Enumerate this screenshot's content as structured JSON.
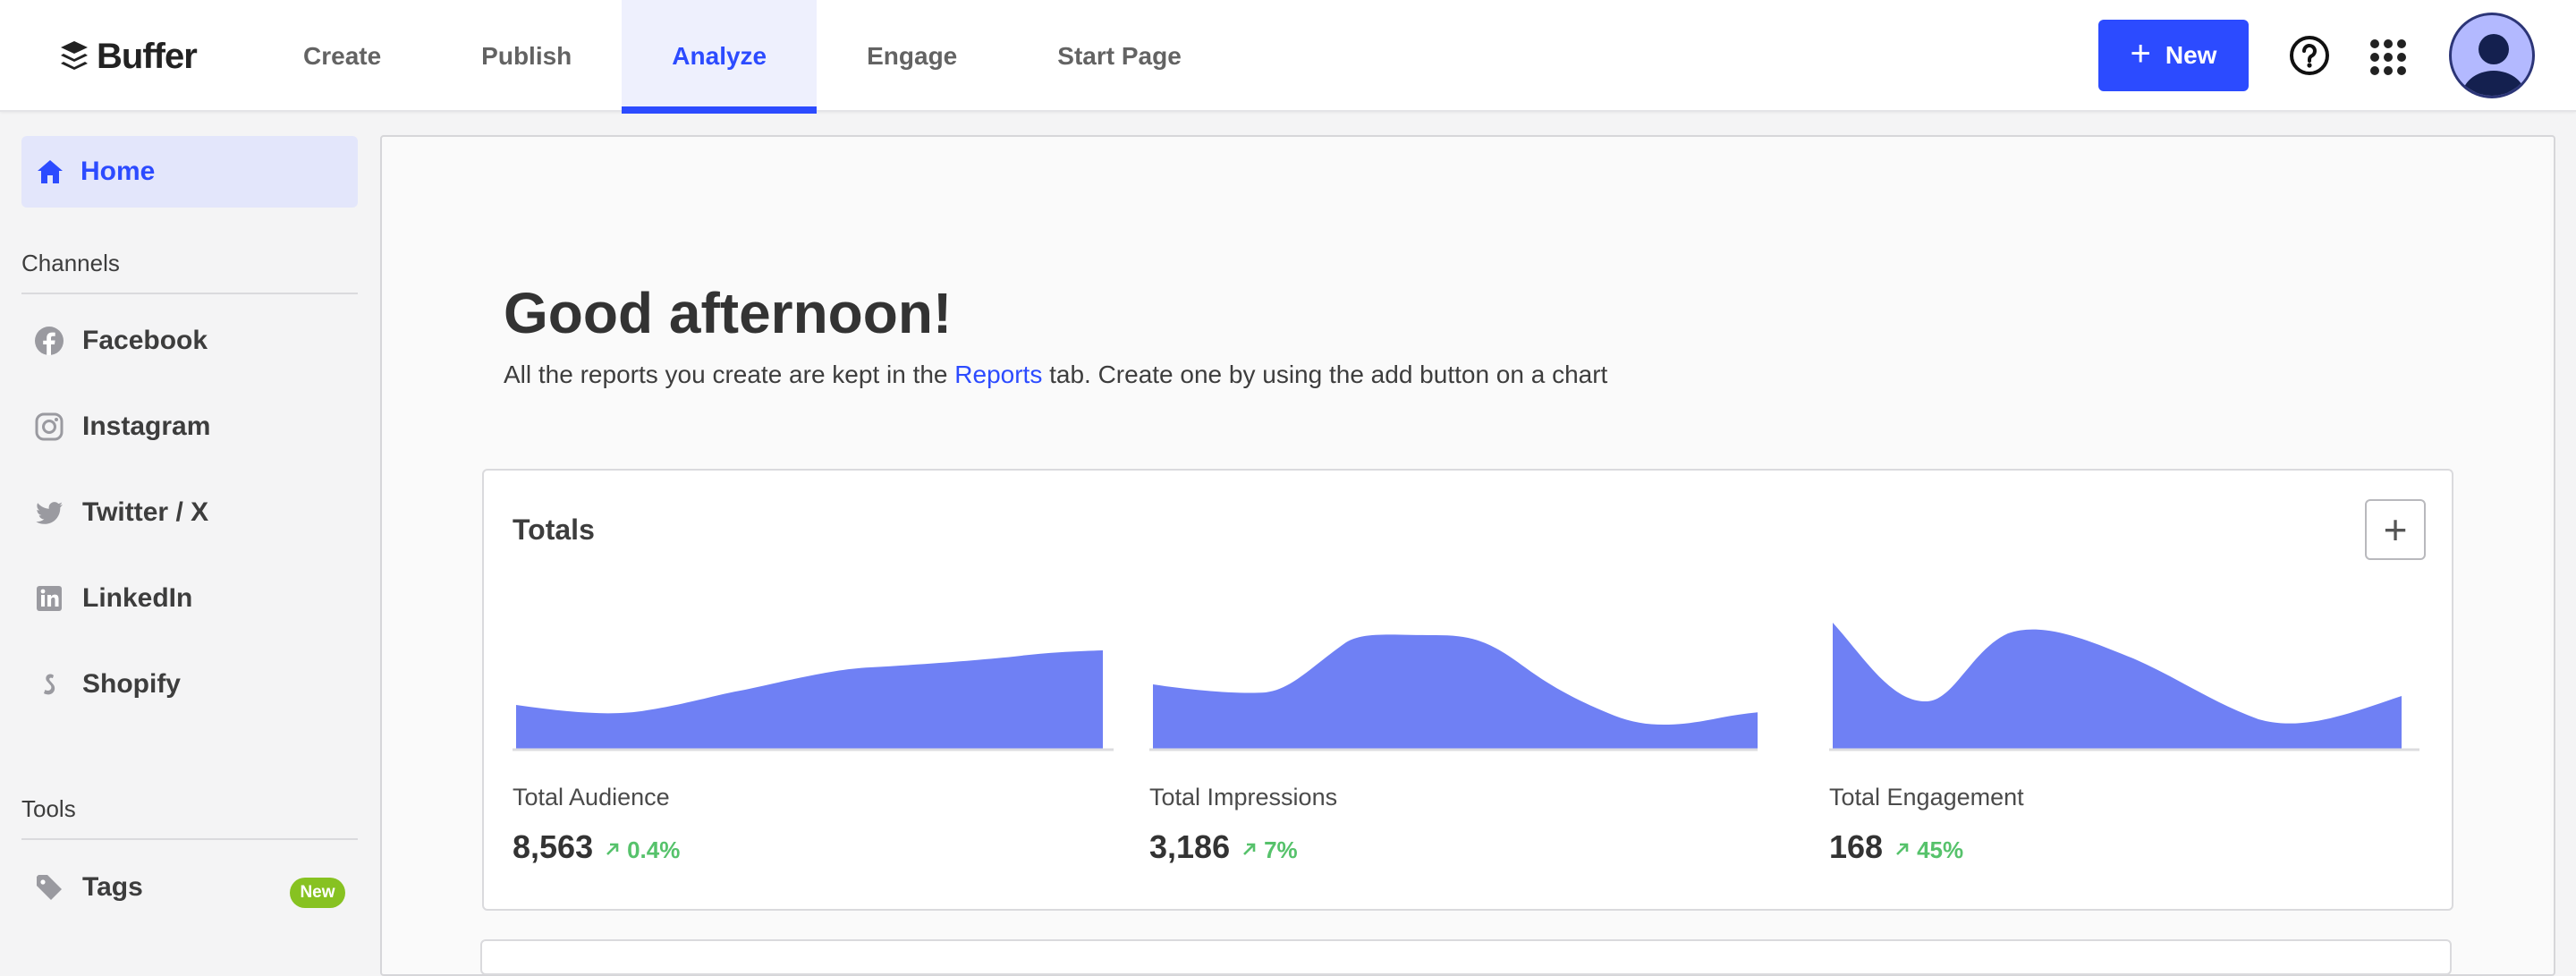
{
  "brand": {
    "name": "Buffer",
    "accent": "#2c4bff",
    "chart_fill": "#6f80f4",
    "positive": "#56c26b"
  },
  "topnav": {
    "tabs": [
      {
        "label": "Create"
      },
      {
        "label": "Publish"
      },
      {
        "label": "Analyze",
        "active": true
      },
      {
        "label": "Engage"
      },
      {
        "label": "Start Page"
      }
    ],
    "new_button": "New",
    "icons": [
      "help-icon",
      "apps-grid-icon",
      "user-avatar"
    ]
  },
  "sidebar": {
    "home": "Home",
    "channels_heading": "Channels",
    "channels": [
      {
        "label": "Facebook",
        "icon": "facebook-icon"
      },
      {
        "label": "Instagram",
        "icon": "instagram-icon"
      },
      {
        "label": "Twitter / X",
        "icon": "twitter-icon"
      },
      {
        "label": "LinkedIn",
        "icon": "linkedin-icon"
      },
      {
        "label": "Shopify",
        "icon": "shopify-icon"
      }
    ],
    "tools_heading": "Tools",
    "tools": [
      {
        "label": "Tags",
        "icon": "tag-icon",
        "badge": "New"
      }
    ]
  },
  "main": {
    "greeting": "Good afternoon!",
    "subtext_before": "All the reports you create are kept in the ",
    "subtext_link": "Reports",
    "subtext_after": " tab. Create one by using the add button on a chart",
    "totals": {
      "title": "Totals",
      "add_button": "+",
      "metrics": [
        {
          "label": "Total Audience",
          "value": "8,563",
          "change": "0.4%",
          "trend": "up"
        },
        {
          "label": "Total Impressions",
          "value": "3,186",
          "change": "7%",
          "trend": "up"
        },
        {
          "label": "Total Engagement",
          "value": "168",
          "change": "45%",
          "trend": "up"
        }
      ]
    }
  }
}
